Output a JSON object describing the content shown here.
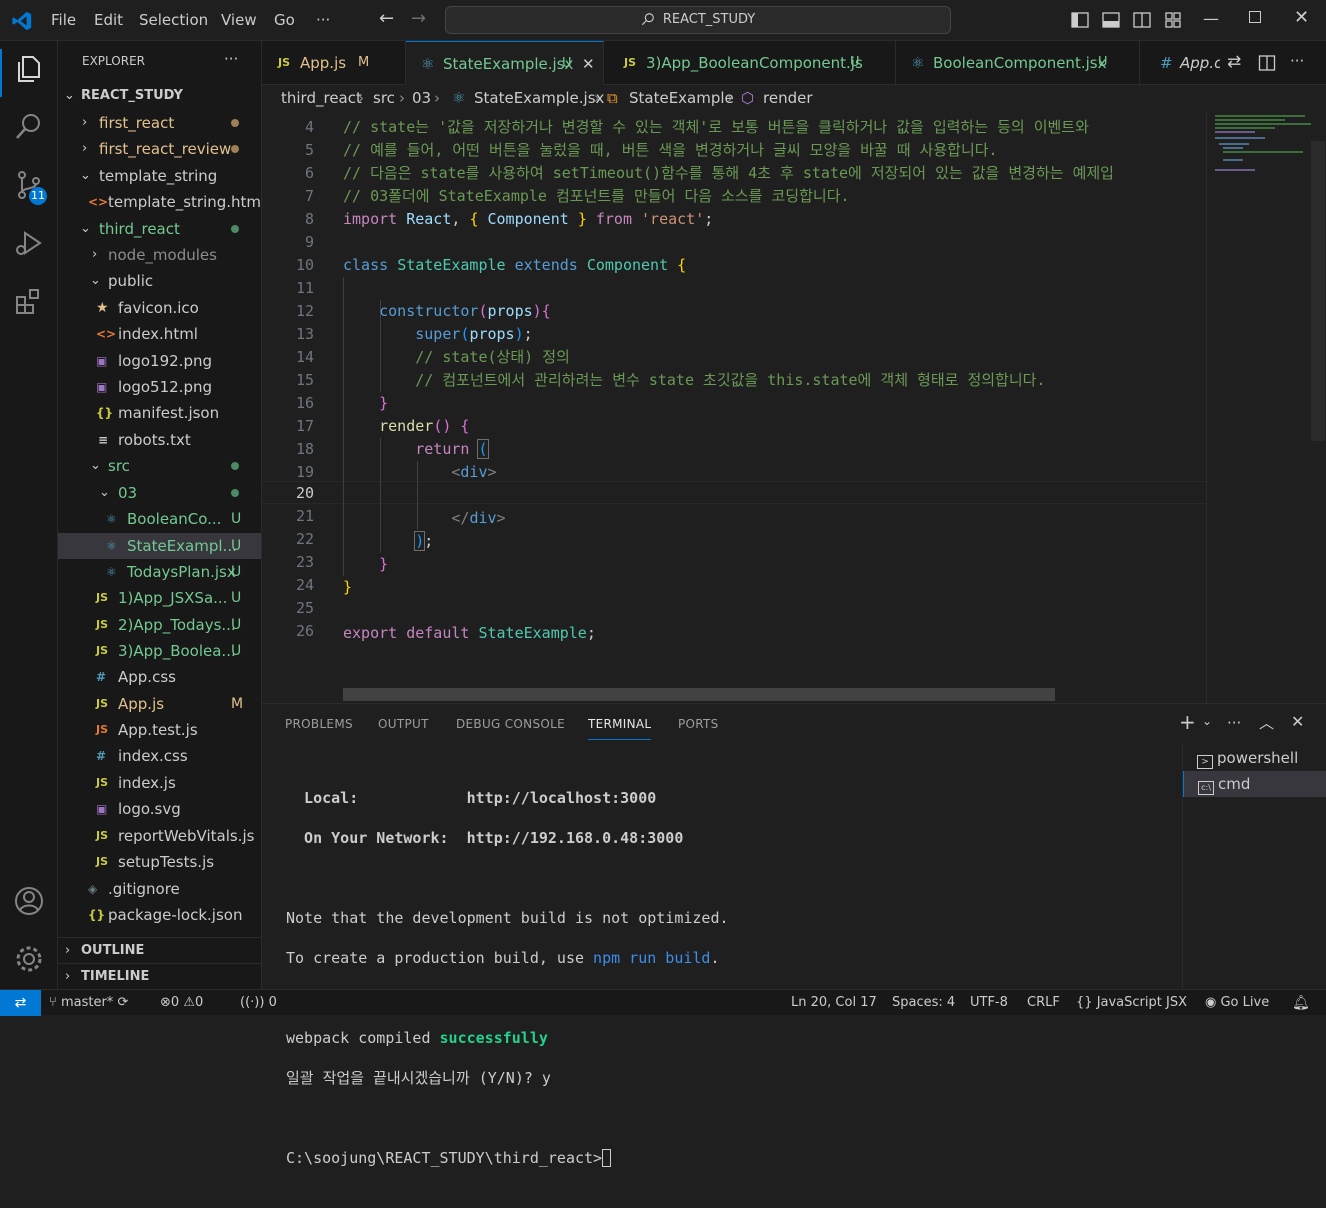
{
  "titlebar": {
    "menus": [
      "File",
      "Edit",
      "Selection",
      "View",
      "Go",
      "···"
    ],
    "search": "REACT_STUDY"
  },
  "explorer": {
    "header": "EXPLORER",
    "more": "···",
    "root": "REACT_STUDY",
    "items": [
      {
        "label": "first_react",
        "status": "dot",
        "color": "#c09553"
      },
      {
        "label": "first_react_review",
        "status": "dot",
        "color": "#c09553"
      },
      {
        "label": "template_string",
        "status": ""
      },
      {
        "label": "template_string.html",
        "status": ""
      },
      {
        "label": "third_react",
        "status": "dot"
      },
      {
        "label": "node_modules",
        "status": ""
      },
      {
        "label": "public",
        "status": ""
      },
      {
        "label": "favicon.ico",
        "status": ""
      },
      {
        "label": "index.html",
        "status": ""
      },
      {
        "label": "logo192.png",
        "status": ""
      },
      {
        "label": "logo512.png",
        "status": ""
      },
      {
        "label": "manifest.json",
        "status": ""
      },
      {
        "label": "robots.txt",
        "status": ""
      },
      {
        "label": "src",
        "status": "dot"
      },
      {
        "label": "03",
        "status": "dot"
      },
      {
        "label": "BooleanCo...",
        "status": "U"
      },
      {
        "label": "StateExampl...",
        "status": "U"
      },
      {
        "label": "TodaysPlan.jsx",
        "status": "U"
      },
      {
        "label": "1)App_JSXSa...",
        "status": "U"
      },
      {
        "label": "2)App_Todays...",
        "status": "U"
      },
      {
        "label": "3)App_Boolea...",
        "status": "U"
      },
      {
        "label": "App.css",
        "status": ""
      },
      {
        "label": "App.js",
        "status": "M"
      },
      {
        "label": "App.test.js",
        "status": ""
      },
      {
        "label": "index.css",
        "status": ""
      },
      {
        "label": "index.js",
        "status": ""
      },
      {
        "label": "logo.svg",
        "status": ""
      },
      {
        "label": "reportWebVitals.js",
        "status": ""
      },
      {
        "label": "setupTests.js",
        "status": ""
      },
      {
        "label": ".gitignore",
        "status": ""
      },
      {
        "label": "package-lock.json",
        "status": ""
      }
    ],
    "outline": "OUTLINE",
    "timeline": "TIMELINE"
  },
  "tabs": [
    {
      "label": "App.js",
      "status": "M"
    },
    {
      "label": "StateExample.jsx",
      "status": "U"
    },
    {
      "label": "3)App_BooleanComponent.js",
      "status": "U"
    },
    {
      "label": "BooleanComponent.jsx",
      "status": "U"
    },
    {
      "label": "App.c",
      "status": ""
    }
  ],
  "breadcrumb": [
    "third_react",
    "src",
    "03",
    "StateExample.jsx",
    "StateExample",
    "render"
  ],
  "editor": {
    "line_numbers": [
      "4",
      "5",
      "6",
      "7",
      "8",
      "9",
      "10",
      "11",
      "12",
      "13",
      "14",
      "15",
      "16",
      "17",
      "18",
      "19",
      "20",
      "21",
      "22",
      "23",
      "24",
      "25",
      "26"
    ],
    "current_line": "20"
  },
  "panel": {
    "tabs": [
      "PROBLEMS",
      "OUTPUT",
      "DEBUG CONSOLE",
      "TERMINAL",
      "PORTS"
    ],
    "active_tab": "TERMINAL",
    "terminal_lines": [
      "  Local:            http://localhost:3000",
      "  On Your Network:  http://192.168.0.48:3000",
      "",
      "Note that the development build is not optimized.",
      "To create a production build, use npm run build.",
      "",
      "webpack compiled successfully",
      "일괄 작업을 끝내시겠습니까 (Y/N)? y",
      "",
      "C:\\soojung\\REACT_STUDY\\third_react>"
    ],
    "terminals": [
      "powershell",
      "cmd"
    ]
  },
  "statusbar": {
    "branch": "master*",
    "errors": "0",
    "warnings": "0",
    "ports": "0",
    "position": "Ln 20, Col 17",
    "spaces": "Spaces: 4",
    "encoding": "UTF-8",
    "eol": "CRLF",
    "language": "JavaScript JSX",
    "golive": "Go Live"
  },
  "colors": {
    "accent": "#0078d4",
    "git_untracked": "#73c991",
    "git_modified": "#e2c08d"
  }
}
